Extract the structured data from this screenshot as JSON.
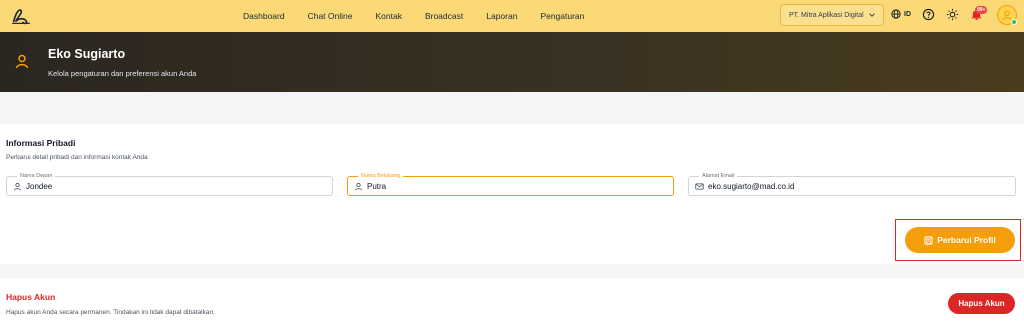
{
  "nav": {
    "items": [
      "Dashboard",
      "Chat Online",
      "Kontak",
      "Broadcast",
      "Laporan",
      "Pengaturan"
    ]
  },
  "topbar": {
    "company": "PT. Mitra Aplikasi Digital",
    "language": "ID",
    "notification_count": "99+"
  },
  "header": {
    "name": "Eko Sugiarto",
    "subtitle": "Kelola pengaturan dan preferensi akun Anda"
  },
  "personal_info": {
    "title": "Informasi Pribadi",
    "description": "Perbarui detail pribadi dan informasi kontak Anda",
    "first_name": {
      "label": "Nama Depan",
      "value": "Jondee"
    },
    "last_name": {
      "label": "Nama Belakang",
      "value": "Putra"
    },
    "email": {
      "label": "Alamat Email",
      "value": "eko.sugiarto@mad.co.id"
    },
    "update_button": "Perbarui Profil"
  },
  "delete_account": {
    "title": "Hapus Akun",
    "description": "Hapus akun Anda secara permanen. Tindakan ini tidak dapat dibatalkan.",
    "button": "Hapus Akun"
  },
  "colors": {
    "topbar": "#fbd977",
    "accent": "#f59e0b",
    "danger": "#dc2626"
  }
}
